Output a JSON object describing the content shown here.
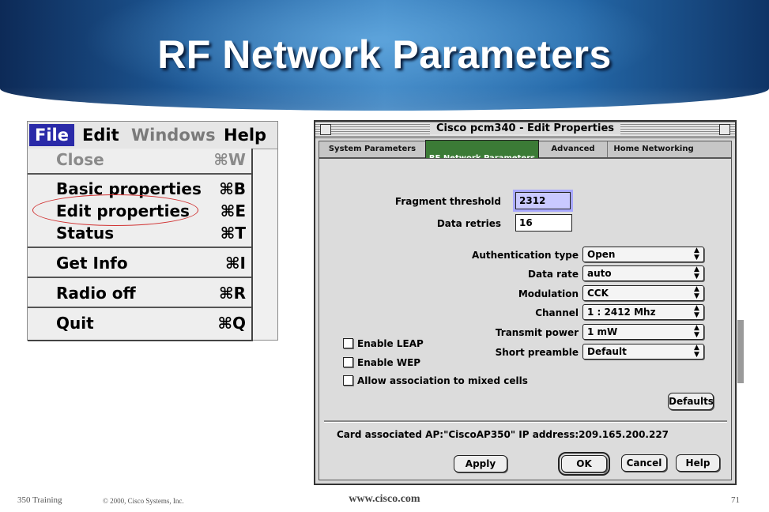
{
  "slide": {
    "title": "RF Network Parameters"
  },
  "menu": {
    "menubar": [
      "File",
      "Edit",
      "Windows",
      "Help"
    ],
    "items": [
      {
        "label": "Close",
        "shortcut": "⌘W"
      },
      {
        "label": "Basic properties",
        "shortcut": "⌘B"
      },
      {
        "label": "Edit properties",
        "shortcut": "⌘E"
      },
      {
        "label": "Status",
        "shortcut": "⌘T"
      },
      {
        "label": "Get Info",
        "shortcut": "⌘I"
      },
      {
        "label": "Radio off",
        "shortcut": "⌘R"
      },
      {
        "label": "Quit",
        "shortcut": "⌘Q"
      }
    ]
  },
  "dialog": {
    "title": "Cisco pcm340 - Edit Properties",
    "tabs": [
      "System Parameters",
      "RF Network Parameters",
      "Advanced",
      "Home Networking"
    ],
    "active_tab": "RF Network Parameters",
    "fragment_threshold": {
      "label": "Fragment threshold",
      "value": "2312"
    },
    "data_retries": {
      "label": "Data retries",
      "value": "16"
    },
    "popups": [
      {
        "label": "Authentication type",
        "value": "Open"
      },
      {
        "label": "Data rate",
        "value": "auto"
      },
      {
        "label": "Modulation",
        "value": "CCK"
      },
      {
        "label": "Channel",
        "value": "1 : 2412 Mhz"
      },
      {
        "label": "Transmit power",
        "value": "1 mW"
      },
      {
        "label": "Short preamble",
        "value": "Default"
      }
    ],
    "checkboxes": [
      "Enable LEAP",
      "Enable WEP",
      "Allow association to mixed cells"
    ],
    "defaults_label": "Defaults",
    "status_text": "Card associated  AP:\"CiscoAP350\"  IP address:209.165.200.227",
    "buttons": {
      "apply": "Apply",
      "ok": "OK",
      "cancel": "Cancel",
      "help": "Help"
    }
  },
  "footer": {
    "course": "350  Training",
    "copyright": "© 2000, Cisco Systems, Inc.",
    "url": "www.cisco.com",
    "page": "71"
  },
  "colors": {
    "banner": "#1e5a98",
    "menu_highlight": "#2a2aa8",
    "active_tab": "#3b7b36",
    "annotation_ellipse": "#d03030"
  }
}
